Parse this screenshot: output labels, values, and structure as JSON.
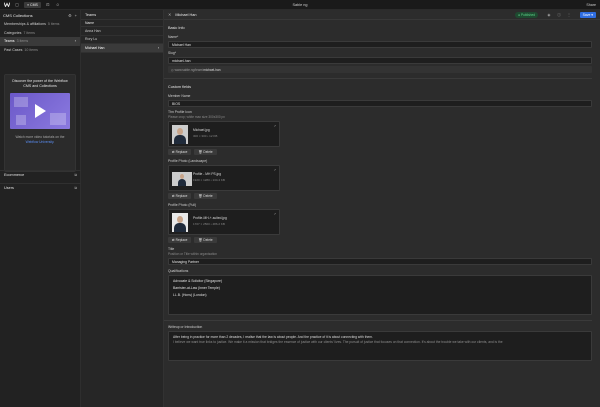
{
  "topbar": {
    "cms_label": "CMS",
    "site_name": "Sable ng",
    "share_label": "Share"
  },
  "collections_panel": {
    "title": "CMS Collections",
    "items": [
      {
        "name": "Memberships & affiliations",
        "count": "5 items"
      },
      {
        "name": "Categories",
        "count": "7 items"
      },
      {
        "name": "Teams",
        "count": "3 items"
      },
      {
        "name": "Past Cases",
        "count": "10 items"
      }
    ],
    "promo": {
      "title": "Discover the power of the Webflow CMS and Collections",
      "text_1": "Watch more video tutorials on the",
      "link": "Webflow University",
      "text_2": "."
    },
    "sections": [
      {
        "label": "Ecommerce"
      },
      {
        "label": "Users"
      }
    ]
  },
  "items_panel": {
    "title": "Teams",
    "column_header": "Name",
    "items": [
      "Anna Han",
      "Rory Lu",
      "Michael Han"
    ]
  },
  "editor": {
    "item_name": "Michael Han",
    "status": "Published",
    "save_label": "Save",
    "basic_info": {
      "title": "Basic Info",
      "name_label": "Name*",
      "name_value": "Michael Han",
      "slug_label": "Slug*",
      "slug_value": "michael-han",
      "slug_url_prefix": "www.sable.ng/team/",
      "slug_url_value": "michael-han"
    },
    "custom_fields": {
      "title": "Custom fields",
      "member_name_label": "Member Name",
      "member_name_value": "BIOS",
      "thn_label": "Thn Profile Icon",
      "thn_hint": "Please crop; white max size 300x300 px",
      "thn_file": {
        "name": "Michael.jpg",
        "meta": "300 × 300 • 12 KB"
      },
      "landscape_label": "Profile Photo (Landscape)",
      "landscape_file": {
        "name": "Profile - MH PS.jpg",
        "meta": "1920 × 1280 • 134.4 KB"
      },
      "full_label": "Profile Photo (Full)",
      "full_file": {
        "name": "Profile-MH-+-suited.jpg",
        "meta": "1707 × 2560 • 486.2 KB"
      },
      "replace_label": "Replace",
      "delete_label": "Delete",
      "title_label": "Title",
      "title_hint": "Position or Title within organisation",
      "title_value": "Managing Partner",
      "qualifications_label": "Qualifications",
      "qualifications": [
        "Advocate & Solicitor (Singapore)",
        "Barrister-at-Law (Inner Temple)",
        "LL.B. (Hons) (London)"
      ],
      "writeup_label": "Writeup or Introduction",
      "writeup_line_1": "After being in practice for more than 2 decades, I realise that the law is about people. And the practice of it is about connecting with them.",
      "writeup_line_2": "I believe we want true links to justice. We make it a mission that bridges the essence of justice with our clients' lives. The pursuit of justice that focuses on that connection. It's about the trouble we take with our clients, and is the"
    }
  }
}
